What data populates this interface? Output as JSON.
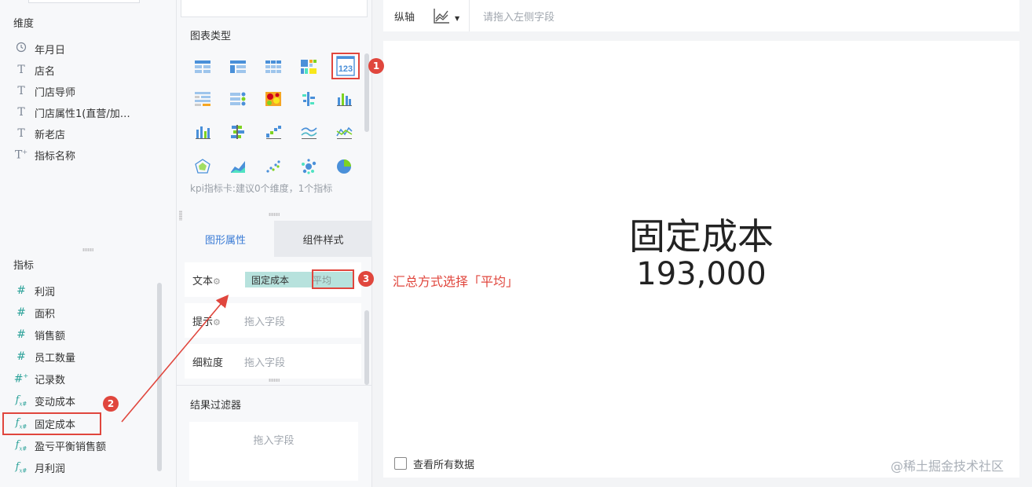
{
  "left": {
    "dimensions_title": "维度",
    "dimensions": [
      {
        "label": "年月日",
        "icon": "clock-icon"
      },
      {
        "label": "店名",
        "icon": "text-type-icon"
      },
      {
        "label": "门店导师",
        "icon": "text-type-icon"
      },
      {
        "label": "门店属性1(直营/加…",
        "icon": "text-type-icon"
      },
      {
        "label": "新老店",
        "icon": "text-type-icon"
      },
      {
        "label": "指标名称",
        "icon": "text-type-derived-icon"
      }
    ],
    "measures_title": "指标",
    "measures": [
      {
        "label": "利润",
        "icon": "number-icon"
      },
      {
        "label": "面积",
        "icon": "number-icon"
      },
      {
        "label": "销售额",
        "icon": "number-icon"
      },
      {
        "label": "员工数量",
        "icon": "number-icon"
      },
      {
        "label": "记录数",
        "icon": "number-derived-icon"
      },
      {
        "label": "变动成本",
        "icon": "formula-icon"
      },
      {
        "label": "固定成本",
        "icon": "formula-icon"
      },
      {
        "label": "盈亏平衡销售额",
        "icon": "formula-icon"
      },
      {
        "label": "月利润",
        "icon": "formula-icon"
      }
    ]
  },
  "chart_types": {
    "title": "图表类型",
    "hint": "kpi指标卡:建议0个维度，1个指标",
    "selected_glyph": "123"
  },
  "tabs": {
    "graph": "图形属性",
    "style": "组件样式"
  },
  "props": {
    "text_label": "文本",
    "text_field": "固定成本",
    "text_agg": "平均",
    "tip_label": "提示",
    "tip_placeholder": "拖入字段",
    "granularity_label": "细粒度",
    "granularity_placeholder": "拖入字段"
  },
  "filter": {
    "title": "结果过滤器",
    "placeholder": "拖入字段"
  },
  "topbar": {
    "axis_label": "纵轴",
    "axis_placeholder": "请拖入左侧字段"
  },
  "canvas": {
    "kpi_name": "固定成本",
    "kpi_value": "193,000",
    "show_all_label": "查看所有数据"
  },
  "annotations": {
    "badge1": "1",
    "badge2": "2",
    "badge3": "3",
    "note3": "汇总方式选择「平均」",
    "accent": "#e0463d"
  },
  "watermark": "@稀土掘金技术社区"
}
